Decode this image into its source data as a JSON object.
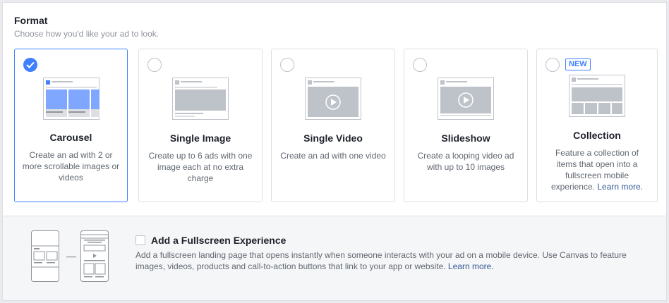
{
  "format": {
    "title": "Format",
    "subtitle": "Choose how you'd like your ad to look."
  },
  "options": [
    {
      "name": "Carousel",
      "description": "Create an ad with 2 or more scrollable images or videos",
      "selected": true
    },
    {
      "name": "Single Image",
      "description": "Create up to 6 ads with one image each at no extra charge",
      "selected": false
    },
    {
      "name": "Single Video",
      "description": "Create an ad with one video",
      "selected": false
    },
    {
      "name": "Slideshow",
      "description": "Create a looping video ad with up to 10 images",
      "selected": false
    },
    {
      "name": "Collection",
      "badge": "NEW",
      "description": "Feature a collection of items that open into a fullscreen mobile experience.",
      "link": "Learn more.",
      "selected": false
    }
  ],
  "fullscreen": {
    "title": "Add a Fullscreen Experience",
    "description": "Add a fullscreen landing page that opens instantly when someone interacts with your ad on a mobile device. Use Canvas to feature images, videos, products and call-to-action buttons that link to your app or website.",
    "link": "Learn more.",
    "checked": false
  },
  "colors": {
    "accent": "#4080ff",
    "link": "#365899"
  }
}
